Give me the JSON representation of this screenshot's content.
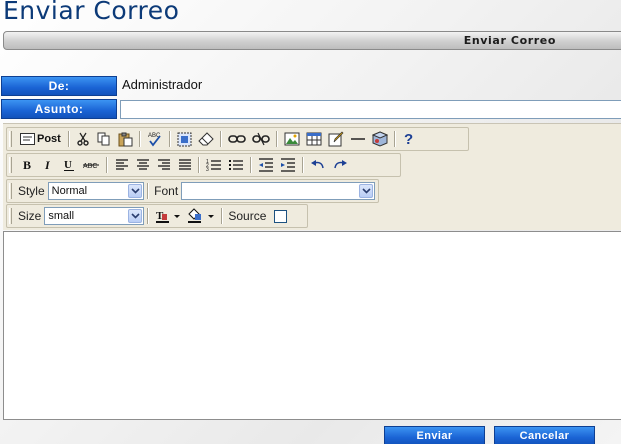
{
  "page": {
    "title": "Enviar Correo"
  },
  "title_bar": {
    "label": "Enviar Correo"
  },
  "form": {
    "from_label": "De:",
    "from_value": "Administrador",
    "subject_label": "Asunto:",
    "subject_value": ""
  },
  "toolbar": {
    "post_label": "Post",
    "style_label": "Style",
    "style_value": "Normal",
    "font_label": "Font",
    "font_value": "",
    "size_label": "Size",
    "size_value": "small",
    "source_label": "Source"
  },
  "editor": {
    "content": ""
  },
  "actions": {
    "send_label": "Enviar",
    "cancel_label": "Cancelar"
  },
  "colors": {
    "title": "#0c3a78",
    "button_blue": "#1a63d4",
    "toolbar_bg": "#efebde"
  }
}
